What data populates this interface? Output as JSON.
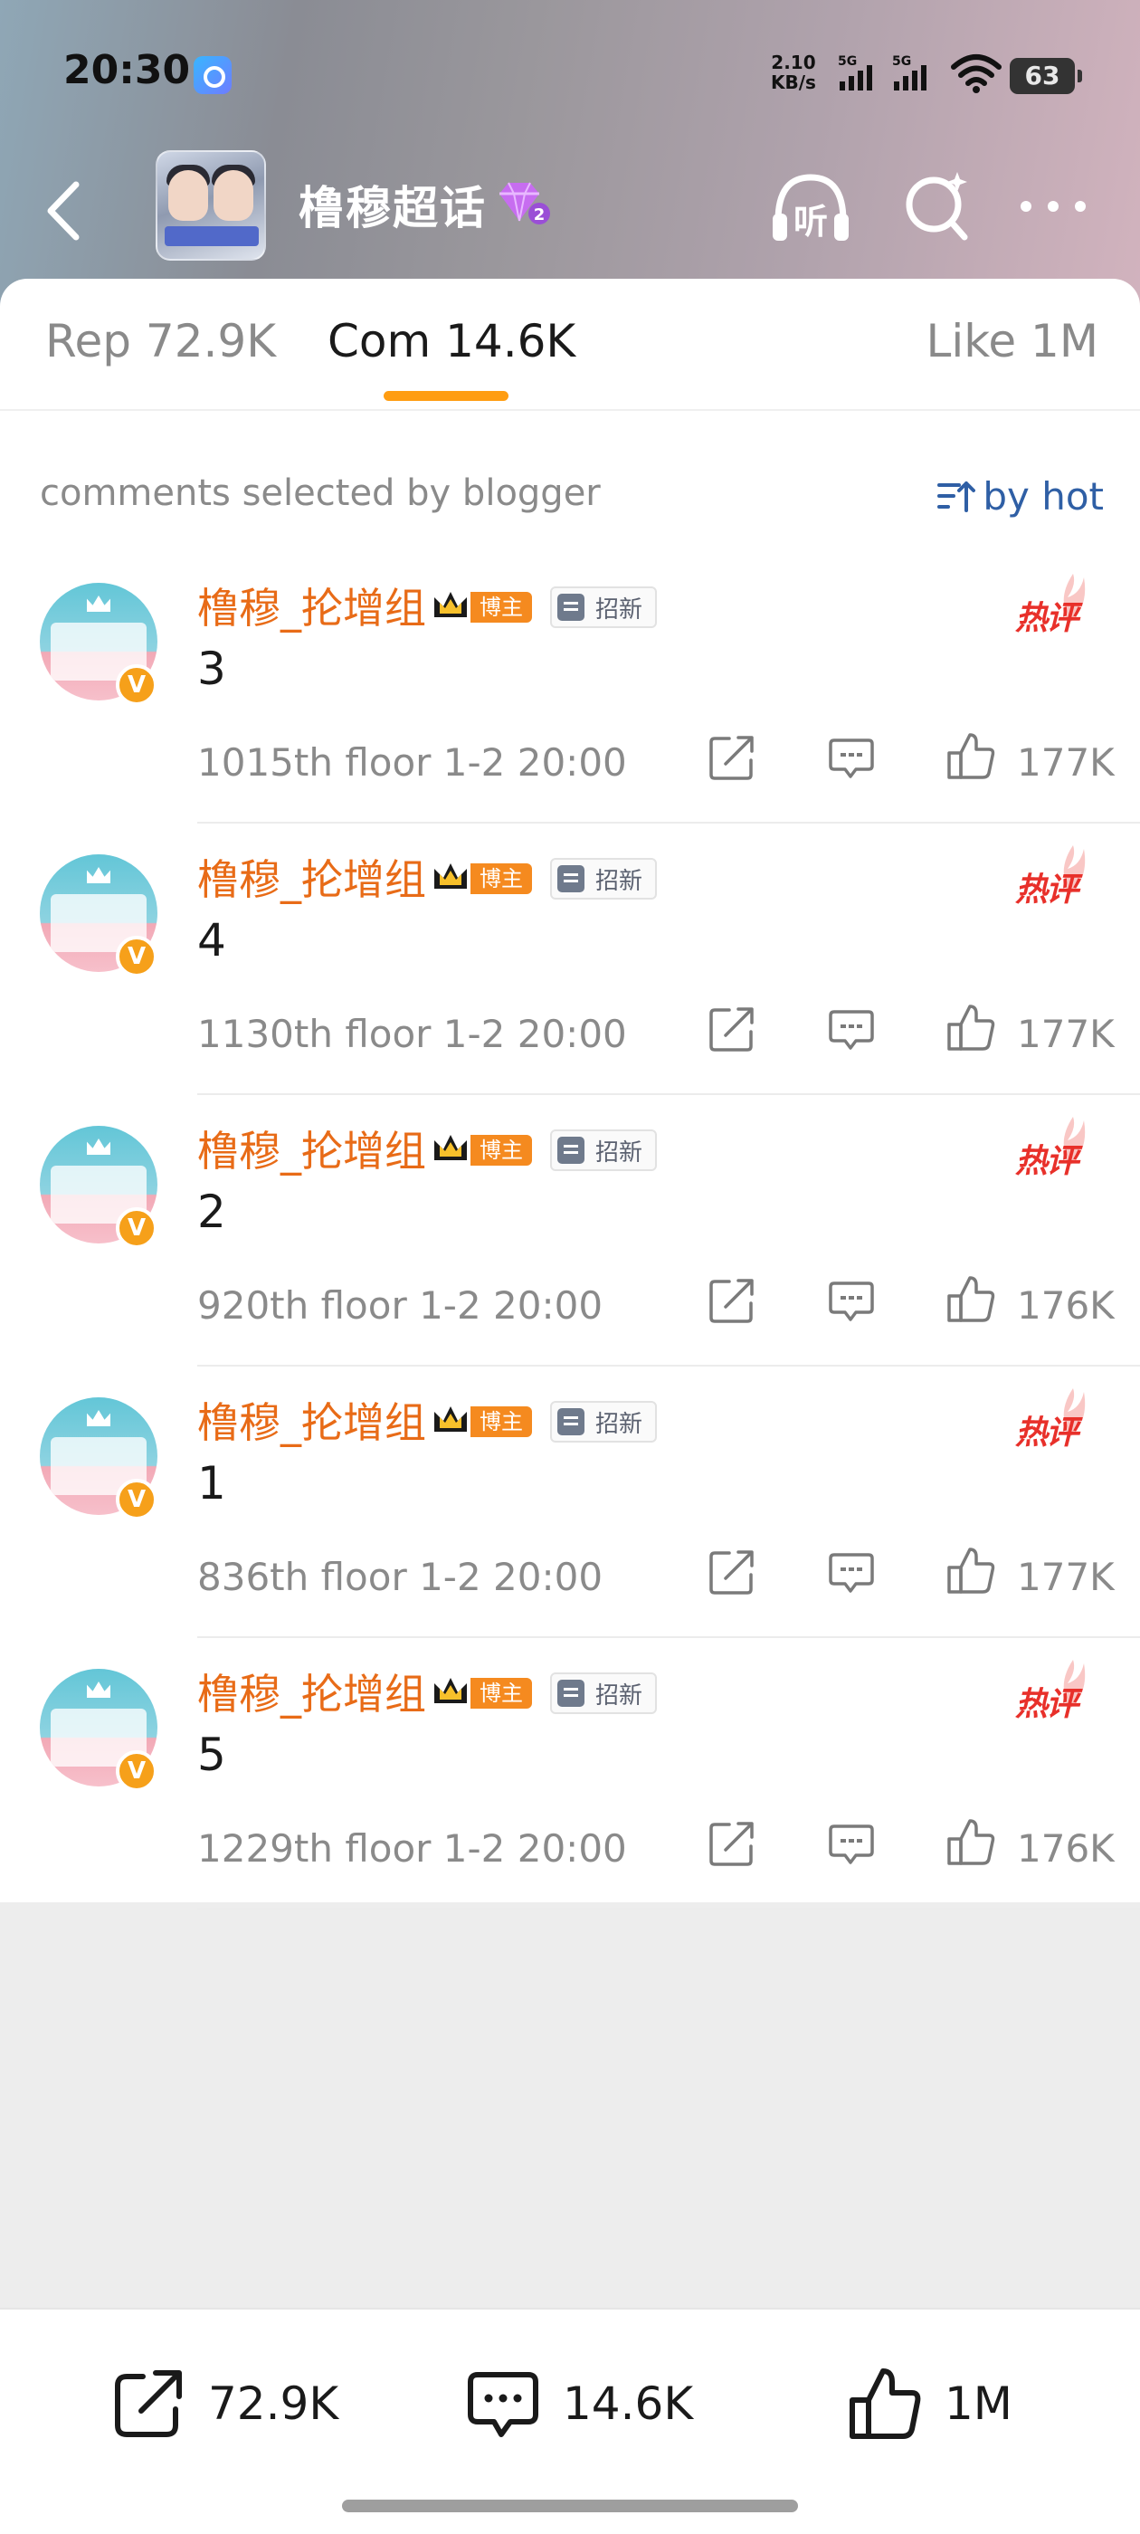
{
  "status_bar": {
    "time": "20:30",
    "net_speed_value": "2.10",
    "net_speed_unit": "KB/s",
    "signal_label_1": "5G",
    "signal_label_2": "5G",
    "battery": "63"
  },
  "nav": {
    "title": "橹穆超话",
    "back_icon": "chevron-left-icon",
    "listen_label": "听",
    "level_badge": "2"
  },
  "tabs": [
    {
      "label": "Rep 72.9K",
      "active": false
    },
    {
      "label": "Com 14.6K",
      "active": true
    },
    {
      "label": "Like 1M",
      "active": false
    }
  ],
  "filter": {
    "label": "comments selected by blogger",
    "sort_label": "by hot"
  },
  "comments": [
    {
      "user": "橹穆_抡增组",
      "badge": "博主",
      "tag": "招新",
      "hot": "热评",
      "text": "3",
      "meta": "1015th floor 1-2 20:00",
      "likes": "177K"
    },
    {
      "user": "橹穆_抡增组",
      "badge": "博主",
      "tag": "招新",
      "hot": "热评",
      "text": "4",
      "meta": "1130th floor 1-2 20:00",
      "likes": "177K"
    },
    {
      "user": "橹穆_抡增组",
      "badge": "博主",
      "tag": "招新",
      "hot": "热评",
      "text": "2",
      "meta": "920th floor 1-2 20:00",
      "likes": "176K"
    },
    {
      "user": "橹穆_抡增组",
      "badge": "博主",
      "tag": "招新",
      "hot": "热评",
      "text": "1",
      "meta": "836th floor 1-2 20:00",
      "likes": "177K"
    },
    {
      "user": "橹穆_抡增组",
      "badge": "博主",
      "tag": "招新",
      "hot": "热评",
      "text": "5",
      "meta": "1229th floor 1-2 20:00",
      "likes": "176K"
    }
  ],
  "bottom_bar": {
    "shares": "72.9K",
    "comments": "14.6K",
    "likes": "1M"
  },
  "colors": {
    "accent": "#ff9d12",
    "username": "#e86b17",
    "link": "#2f5fa5",
    "hot": "#e8302a"
  }
}
